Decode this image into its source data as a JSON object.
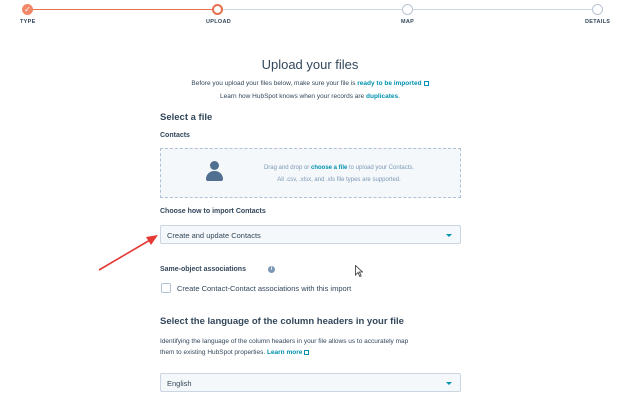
{
  "stepper": {
    "steps": [
      {
        "label": "TYPE",
        "state": "complete"
      },
      {
        "label": "UPLOAD",
        "state": "active"
      },
      {
        "label": "MAP",
        "state": "upcoming"
      },
      {
        "label": "DETAILS",
        "state": "upcoming"
      }
    ],
    "checkmark": "✓"
  },
  "main": {
    "title": "Upload your files",
    "intro_line1_prefix": "Before you upload your files below, make sure your file is",
    "intro_line1_link": "ready to be imported",
    "intro_line2_prefix": "Learn how HubSpot knows when your records are",
    "intro_line2_link": "duplicates",
    "intro_line2_suffix": "."
  },
  "select_file": {
    "heading": "Select a file",
    "object_label": "Contacts",
    "dropzone_prefix": "Drag and drop or",
    "dropzone_link": "choose a file",
    "dropzone_suffix": "to upload your Contacts.",
    "dropzone_formats": "All .csv, .xlsx, and .xls file types are supported."
  },
  "import_mode": {
    "label": "Choose how to import Contacts",
    "selected": "Create and update Contacts"
  },
  "associations": {
    "label": "Same-object associations",
    "info_glyph": "i",
    "checkbox_label": "Create Contact-Contact associations with this import",
    "checked": false
  },
  "language": {
    "heading": "Select the language of the column headers in your file",
    "desc_line1": "Identifying the language of the column headers in your file allows us to accurately map",
    "desc_line2_prefix": "them to existing HubSpot properties.",
    "desc_link": "Learn more",
    "selected": "English"
  },
  "colors": {
    "accent": "#e8704f",
    "link": "#0091ae",
    "text": "#33475b",
    "annotation_arrow": "#e53935"
  }
}
